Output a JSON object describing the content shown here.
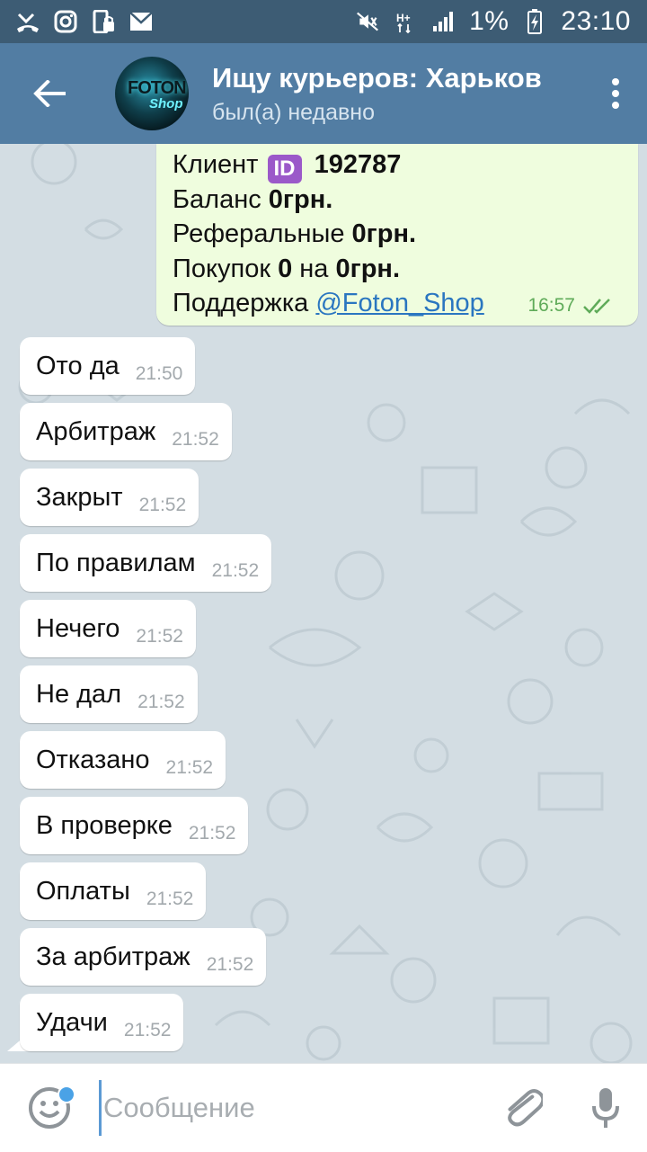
{
  "status_bar": {
    "battery": "1%",
    "time": "23:10",
    "left_icons": [
      "missed-call-icon",
      "instagram-icon",
      "phone-lock-icon",
      "mail-icon"
    ],
    "right_icons": [
      "mute-icon",
      "data-hplus-icon",
      "signal-icon",
      "battery-charging-icon"
    ]
  },
  "header": {
    "title": "Ищу курьеров: Харьков",
    "subtitle": "был(а) недавно",
    "avatar_text_1": "FOTON",
    "avatar_text_2": "Shop"
  },
  "outgoing_message": {
    "client_label": "Клиент",
    "client_id": "192787",
    "balance_label": "Баланс",
    "balance_value": "0грн.",
    "referral_label": "Реферальные",
    "referral_value": "0грн.",
    "purchases_label": "Покупок",
    "purchases_count": "0",
    "purchases_on": "на",
    "purchases_value": "0грн.",
    "support_label": "Поддержка",
    "support_link": "@Foton_Shop",
    "time": "16:57",
    "id_badge": "ID"
  },
  "incoming_messages": [
    {
      "text": "Ото да",
      "time": "21:50"
    },
    {
      "text": "Арбитраж",
      "time": "21:52"
    },
    {
      "text": "Закрыт",
      "time": "21:52"
    },
    {
      "text": "По правилам",
      "time": "21:52"
    },
    {
      "text": "Нечего",
      "time": "21:52"
    },
    {
      "text": "Не дал",
      "time": "21:52"
    },
    {
      "text": "Отказано",
      "time": "21:52"
    },
    {
      "text": "В проверке",
      "time": "21:52"
    },
    {
      "text": "Оплаты",
      "time": "21:52"
    },
    {
      "text": "За арбитраж",
      "time": "21:52"
    },
    {
      "text": "Удачи",
      "time": "21:52"
    }
  ],
  "input": {
    "placeholder": "Сообщение",
    "value": ""
  },
  "colors": {
    "status_bar": "#3d5c74",
    "toolbar": "#527da3",
    "chat_bg": "#d3dde3",
    "outgoing_bubble": "#effdde",
    "incoming_bubble": "#ffffff",
    "link": "#2a76c0",
    "check_marks": "#5fab59"
  }
}
